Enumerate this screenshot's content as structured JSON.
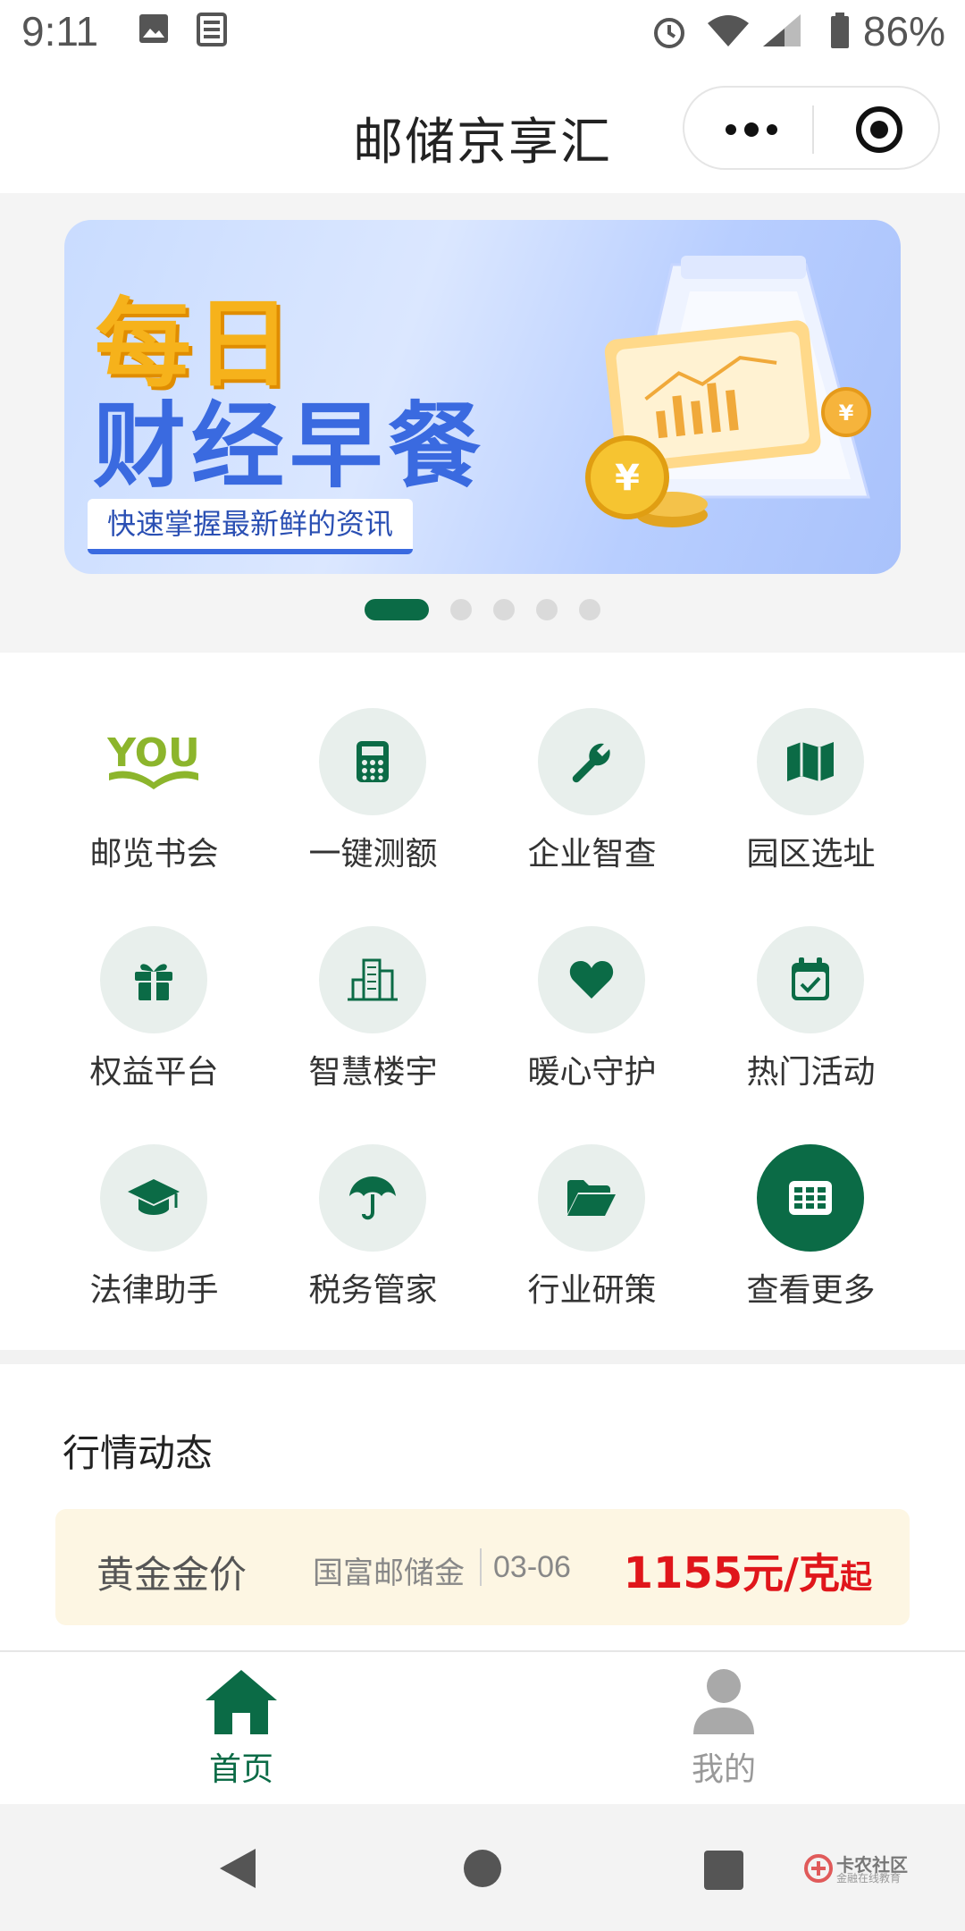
{
  "status_bar": {
    "time": "9:11",
    "battery": "86%"
  },
  "header": {
    "title": "邮储京享汇"
  },
  "banner": {
    "line1": "每日",
    "line2": "财经早餐",
    "tag": "快速掌握最新鲜的资讯"
  },
  "grid": {
    "items": [
      {
        "label": "邮览书会",
        "icon": "you-logo-icon"
      },
      {
        "label": "一键测额",
        "icon": "calculator-icon"
      },
      {
        "label": "企业智查",
        "icon": "wrench-icon"
      },
      {
        "label": "园区选址",
        "icon": "map-icon"
      },
      {
        "label": "权益平台",
        "icon": "gift-icon"
      },
      {
        "label": "智慧楼宇",
        "icon": "building-icon"
      },
      {
        "label": "暖心守护",
        "icon": "heart-icon"
      },
      {
        "label": "热门活动",
        "icon": "calendar-check-icon"
      },
      {
        "label": "法律助手",
        "icon": "graduation-cap-icon"
      },
      {
        "label": "税务管家",
        "icon": "umbrella-icon"
      },
      {
        "label": "行业研策",
        "icon": "folder-open-icon"
      },
      {
        "label": "查看更多",
        "icon": "grid-icon"
      }
    ]
  },
  "market": {
    "heading": "行情动态",
    "gold": {
      "name": "黄金金价",
      "source": "国富邮储金",
      "date": "03-06",
      "price": "1155",
      "unit": "元/克",
      "suffix": "起"
    }
  },
  "tabbar": {
    "home": "首页",
    "mine": "我的"
  },
  "watermark": {
    "line1": "卡农社区",
    "line2": "金融在线教育"
  },
  "colors": {
    "brand_green": "#0b6b46",
    "price_red": "#e0161b",
    "icon_bg": "#e8efec"
  }
}
